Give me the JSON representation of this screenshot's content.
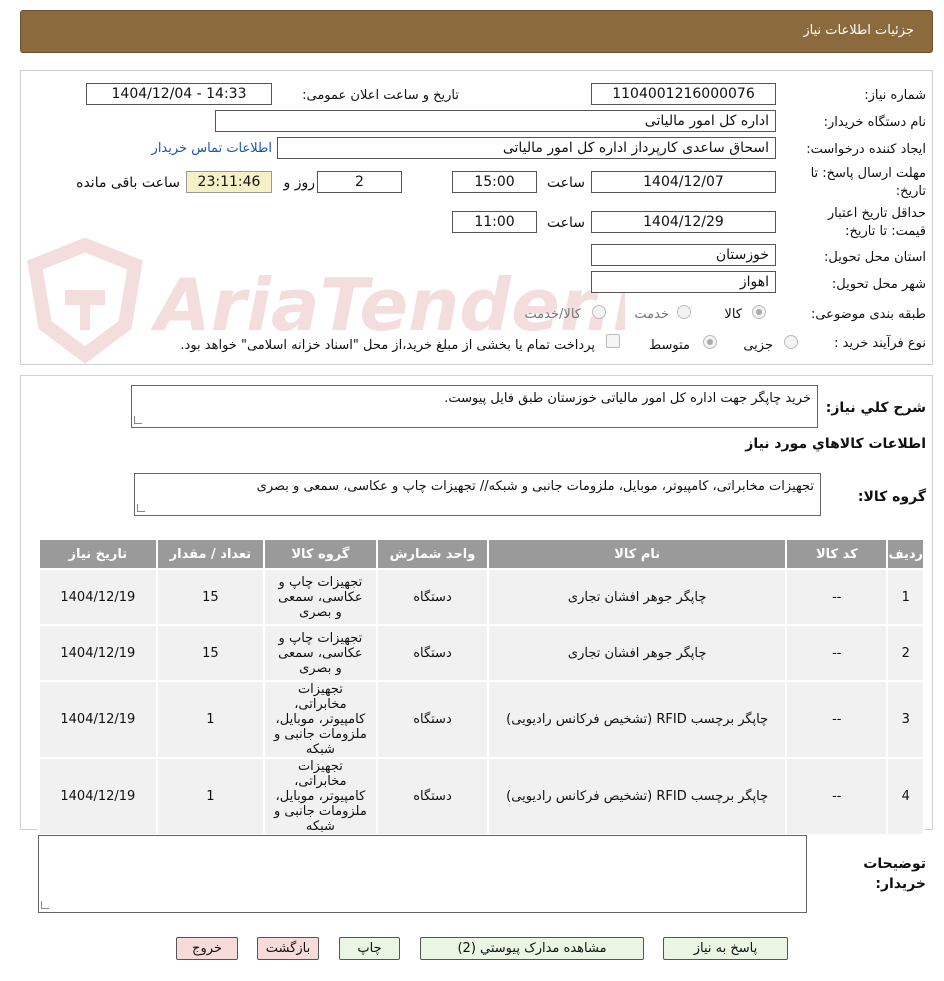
{
  "header": {
    "title": "جزئیات اطلاعات نیاز"
  },
  "watermark": {
    "text": "AriaTender.neT",
    "color": "#b00000"
  },
  "form": {
    "need_number": {
      "label": "شماره نیاز:",
      "value": "1104001216000076"
    },
    "announce": {
      "label": "تاریخ و ساعت اعلان عمومی:",
      "value": "1404/12/04 - 14:33"
    },
    "buyer_org": {
      "label": "نام دستگاه خریدار:",
      "value": "اداره کل امور مالیاتی"
    },
    "requester": {
      "label": "ایجاد کننده درخواست:",
      "value": "اسحاق ساعدی کارپرداز اداره کل امور مالیاتی",
      "contact_link": "اطلاعات تماس خریدار"
    },
    "reply_deadline": {
      "label_line1": "مهلت ارسال پاسخ: تا",
      "label_line2": "تاریخ:",
      "date": "1404/12/07",
      "time_label": "ساعت",
      "time": "15:00",
      "days": "2",
      "days_label": "روز و",
      "remaining": "23:11:46",
      "remaining_label": "ساعت باقی مانده"
    },
    "validity": {
      "label_line1": "حداقل تاریخ اعتبار",
      "label_line2": "قیمت: تا تاریخ:",
      "date": "1404/12/29",
      "time_label": "ساعت",
      "time": "11:00"
    },
    "province": {
      "label": "استان محل تحویل:",
      "value": "خوزستان"
    },
    "city": {
      "label": "شهر محل تحویل:",
      "value": "اهواز"
    },
    "category": {
      "label": "طبقه بندی موضوعی:",
      "options": [
        "کالا",
        "خدمت",
        "کالا/خدمت"
      ]
    },
    "process": {
      "label": "نوع فرآیند خرید :",
      "options": [
        "جزیی",
        "متوسط"
      ],
      "note": "پرداخت تمام یا بخشی از مبلغ خرید،از محل \"اسناد خزانه اسلامی\" خواهد بود."
    }
  },
  "summary": {
    "label": "شرح کلي نياز:",
    "value": "خرید چاپگر جهت اداره کل امور مالیاتی خوزستان طبق فایل پیوست."
  },
  "goods_info": {
    "title": "اطلاعات کالاهاي مورد نياز"
  },
  "goods_group": {
    "label": "گروه کالا:",
    "value": "تجهیزات مخابراتی، کامپیوتر، موبایل، ملزومات جانبی و شبکه// تجهیزات چاپ و عکاسی، سمعی و بصری"
  },
  "table": {
    "headers": [
      "ردیف",
      "کد کالا",
      "نام کالا",
      "واحد شمارش",
      "گروه کالا",
      "تعداد / مقدار",
      "تاریخ نیاز"
    ],
    "rows": [
      {
        "row": "1",
        "code": "--",
        "name": "چاپگر جوهر افشان تجاری",
        "unit": "دستگاه",
        "group": "تجهیزات چاپ و عکاسی، سمعی و بصری",
        "qty": "15",
        "date": "1404/12/19"
      },
      {
        "row": "2",
        "code": "--",
        "name": "چاپگر جوهر افشان تجاری",
        "unit": "دستگاه",
        "group": "تجهیزات چاپ و عکاسی، سمعی و بصری",
        "qty": "15",
        "date": "1404/12/19"
      },
      {
        "row": "3",
        "code": "--",
        "name": "چاپگر برچسب RFID (تشخیص فرکانس رادیویی)",
        "unit": "دستگاه",
        "group": "تجهیزات مخابراتی، کامپیوتر، موبایل، ملزومات جانبی و شبکه",
        "qty": "1",
        "date": "1404/12/19"
      },
      {
        "row": "4",
        "code": "--",
        "name": "چاپگر برچسب RFID (تشخیص فرکانس رادیویی)",
        "unit": "دستگاه",
        "group": "تجهیزات مخابراتی، کامپیوتر، موبایل، ملزومات جانبی و شبکه",
        "qty": "1",
        "date": "1404/12/19"
      }
    ]
  },
  "buyer_notes": {
    "label_line1": "توضیحات",
    "label_line2": "خریدار:",
    "value": ""
  },
  "buttons": {
    "reply": "پاسخ به نیاز",
    "docs": "مشاهده مدارک پیوستي (2)",
    "print": "چاپ",
    "back": "بازگشت",
    "exit": "خروج"
  }
}
